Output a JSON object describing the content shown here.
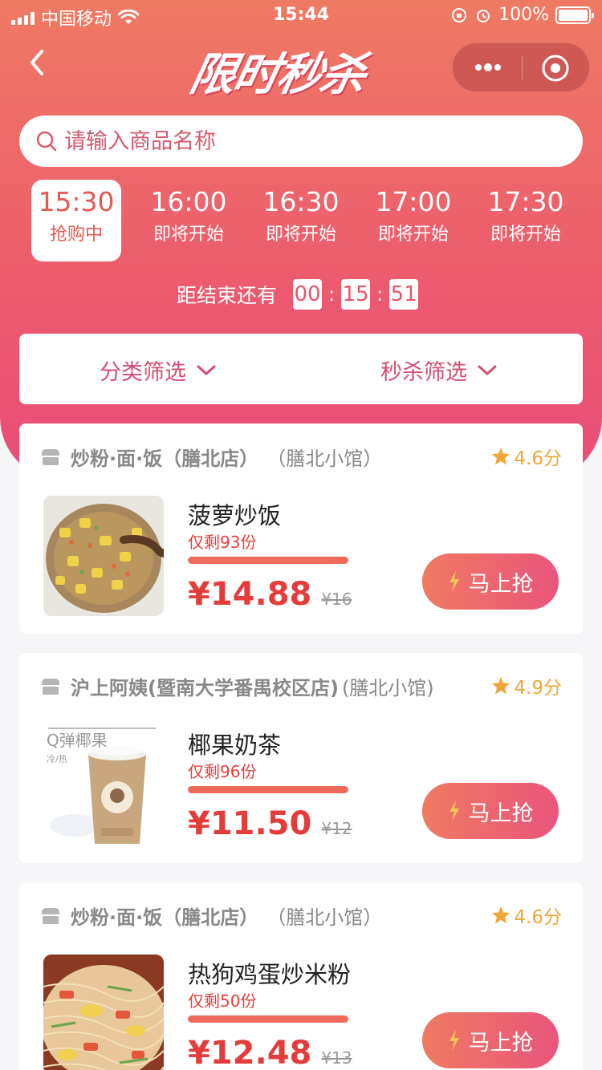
{
  "status_bar": {
    "carrier": "中国移动",
    "time": "15:44",
    "battery": "100%"
  },
  "header": {
    "title": "限时秒杀"
  },
  "search": {
    "placeholder": "请输入商品名称"
  },
  "time_slots": [
    {
      "time": "15:30",
      "label": "抢购中",
      "active": true
    },
    {
      "time": "16:00",
      "label": "即将开始",
      "active": false
    },
    {
      "time": "16:30",
      "label": "即将开始",
      "active": false
    },
    {
      "time": "17:00",
      "label": "即将开始",
      "active": false
    },
    {
      "time": "17:30",
      "label": "即将开始",
      "active": false
    }
  ],
  "countdown": {
    "label": "距结束还有",
    "hours": "00",
    "minutes": "15",
    "seconds": "51"
  },
  "filters": {
    "category": "分类筛选",
    "seckill": "秒杀筛选"
  },
  "products": [
    {
      "shop": "炒粉·面·饭（膳北店）",
      "branch": "（膳北小馆）",
      "rating": "4.6分",
      "title": "菠萝炒饭",
      "remain": "仅剩93份",
      "progress": 1.0,
      "price": "¥14.88",
      "original_price": "¥16",
      "button": "马上抢"
    },
    {
      "shop": "沪上阿姨(暨南大学番禺校区店)",
      "branch": "(膳北小馆)",
      "rating": "4.9分",
      "title": "椰果奶茶",
      "remain": "仅剩96份",
      "progress": 1.0,
      "price": "¥11.50",
      "original_price": "¥12",
      "button": "马上抢",
      "thumb_text": "Q弹椰果",
      "thumb_sub": "冷/热"
    },
    {
      "shop": "炒粉·面·饭（膳北店）",
      "branch": "（膳北小馆）",
      "rating": "4.6分",
      "title": "热狗鸡蛋炒米粉",
      "remain": "仅剩50份",
      "progress": 1.0,
      "price": "¥12.48",
      "original_price": "¥13",
      "button": "马上抢"
    }
  ],
  "colors": {
    "accent": "#e9557b",
    "price": "#e43c3a",
    "rating": "#f0a63a"
  }
}
